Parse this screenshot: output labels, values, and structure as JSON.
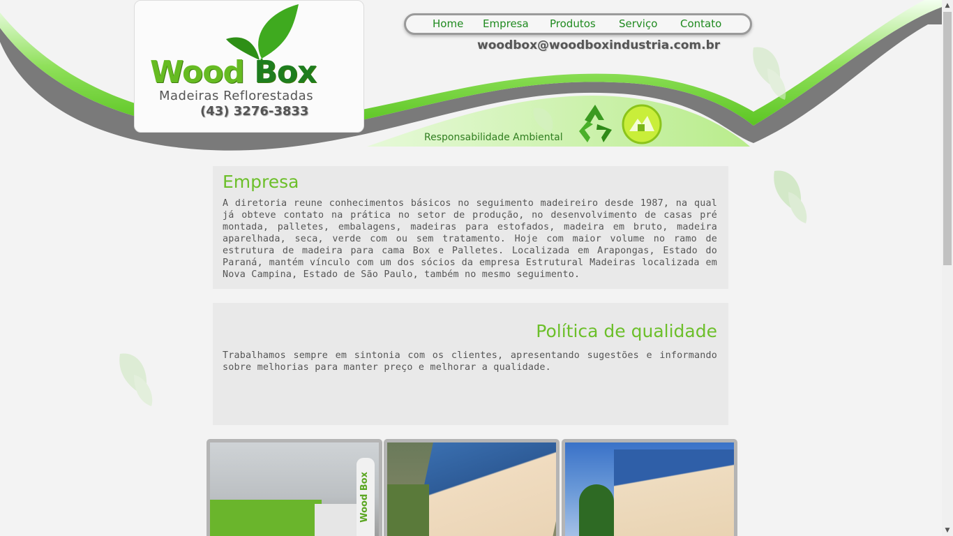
{
  "logo": {
    "word1": "Wood",
    "word2": "Box",
    "tagline": "Madeiras Reflorestadas",
    "phone": "(43) 3276-3833"
  },
  "nav": {
    "items": [
      "Home",
      "Empresa",
      "Produtos",
      "Serviço",
      "Contato"
    ]
  },
  "email": "woodbox@woodboxindustria.com.br",
  "banner": {
    "label": "Responsabilidade Ambiental"
  },
  "empresa": {
    "title": "Empresa",
    "text": "A diretoria reune conhecimentos básicos no seguimento madeireiro desde 1987, na qual já obteve contato na prática no setor de produção, no desenvolvimento de casas pré montada, palletes, embalagens, madeiras para estofados, madeira em bruto, madeira aparelhada, seca, verde com ou sem tratamento. Hoje com maior volume no ramo de estrutura de madeira para cama Box e Palletes. Localizada em Arapongas, Estado do Paraná, mantém vínculo com um dos sócios da empresa Estrutural Madeiras localizada em Nova Campina, Estado de São Paulo, também no mesmo seguimento."
  },
  "qualidade": {
    "title": "Política de qualidade",
    "text": "Trabalhamos sempre em sintonia com os clientes, apresentando sugestões e informando sobre melhorias para manter preço e melhorar a qualidade."
  },
  "photos": [
    {
      "sign": "Wood Box"
    },
    {
      "sign": ""
    },
    {
      "sign": ""
    }
  ],
  "colors": {
    "green": "#6cbf2a",
    "dark_green": "#1f8a1f",
    "gray_band": "#777777"
  }
}
